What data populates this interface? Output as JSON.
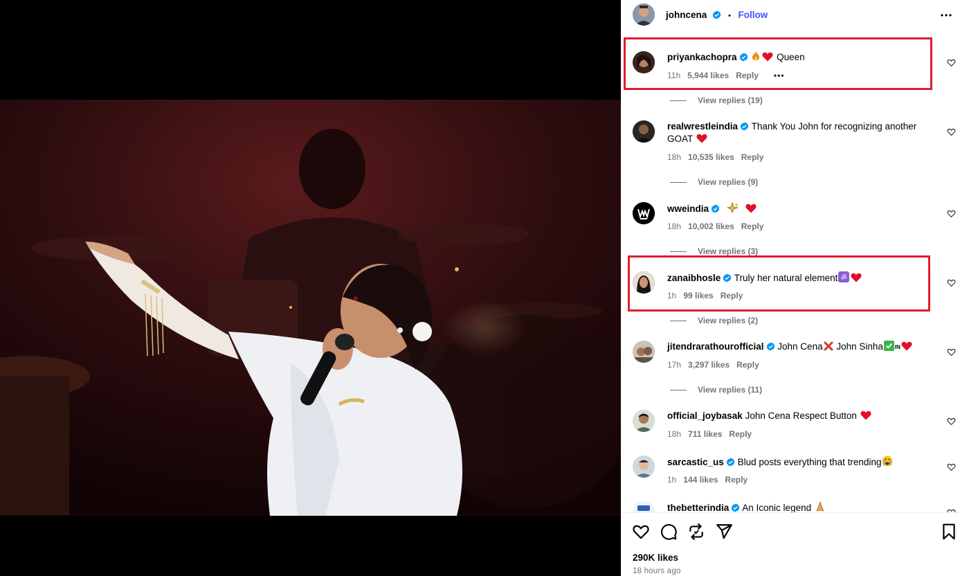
{
  "post": {
    "author": "johncena",
    "follow_label": "Follow",
    "separator": "•"
  },
  "comments": [
    {
      "user": "priyankachopra",
      "text": "Queen",
      "time": "11h",
      "likes": "5,944 likes",
      "reply": "Reply",
      "more": "•••",
      "view_replies": "View replies (19)"
    },
    {
      "user": "realwrestleindia",
      "text": "Thank You John for recognizing another GOAT",
      "time": "18h",
      "likes": "10,535 likes",
      "reply": "Reply",
      "view_replies": "View replies (9)"
    },
    {
      "user": "wweindia",
      "text": "",
      "time": "18h",
      "likes": "10,002 likes",
      "reply": "Reply",
      "view_replies": "View replies (3)"
    },
    {
      "user": "zanaibhosle",
      "text": "Truly her natural element",
      "time": "1h",
      "likes": "99 likes",
      "reply": "Reply",
      "view_replies": "View replies (2)"
    },
    {
      "user": "jitendrarathourofficial",
      "text_a": "John Cena",
      "text_b": "John Sinha",
      "text_c": "IN",
      "time": "17h",
      "likes": "3,297 likes",
      "reply": "Reply",
      "view_replies": "View replies (11)"
    },
    {
      "user": "official_joybasak",
      "text": "John Cena Respect Button",
      "time": "18h",
      "likes": "711 likes",
      "reply": "Reply"
    },
    {
      "user": "sarcastic_us",
      "text": "Blud posts everything that trending",
      "time": "1h",
      "likes": "144 likes",
      "reply": "Reply"
    },
    {
      "user": "thebetterindia",
      "text": "An Iconic legend"
    }
  ],
  "footer": {
    "likes": "290K likes",
    "time_ago": "18 hours ago"
  },
  "icons": {
    "like": "heart-icon",
    "comment": "comment-icon",
    "repost": "repost-icon",
    "share": "send-icon",
    "save": "bookmark-icon",
    "more": "more-icon",
    "verified": "verified-badge-icon"
  },
  "colors": {
    "accent": "#4150f7",
    "verified": "#0095f6",
    "highlight": "#e11d2a",
    "meta": "#737373",
    "heart": "#e0102a"
  }
}
